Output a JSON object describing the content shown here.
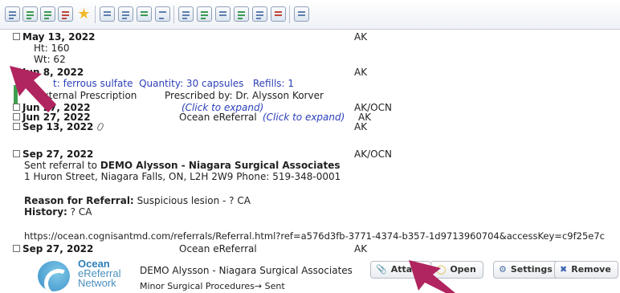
{
  "colors": {
    "accent_link": "#2b3fb8",
    "checkbox_checked": "#2a6fc9",
    "annotation_arrow": "#b0245f",
    "green_bar": "#3f9e4c"
  },
  "toolbar": {
    "icons": [
      "new-document-icon",
      "import-icon",
      "export-icon",
      "tools-icon",
      "star-icon",
      "scale-icon",
      "grid-icon",
      "history-icon",
      "chart-icon",
      "note-icon",
      "scan-icon",
      "lab-icon",
      "image-icon",
      "flowsheet-icon",
      "forms-icon",
      "graph-icon"
    ]
  },
  "entries": {
    "may13": {
      "date": "May 13, 2022",
      "provider": "AK",
      "ht": "Ht:  160",
      "wt": "Wt: 62"
    },
    "jun8": {
      "date": "Jun 8, 2022",
      "provider": "AK",
      "rx_prefix": "t:",
      "drug": "ferrous sulfate",
      "quantity": "Quantity: 30 capsules",
      "refills": "Refills: 1",
      "external": "External Prescription",
      "prescribed_by": "Prescribed by: Dr. Alysson Korver"
    },
    "jun27a": {
      "date": "Jun 27, 2022",
      "expand": "(Click to expand)",
      "provider": "AK/OCN"
    },
    "jun27b": {
      "date": "Jun 27, 2022",
      "label": "Ocean eReferral",
      "expand": "(Click to expand)",
      "provider": "AK"
    },
    "sep13": {
      "date": "Sep 13, 2022",
      "provider": "AK"
    },
    "sep27a": {
      "date": "Sep 27, 2022",
      "provider": "AK/OCN",
      "sent_prefix": "Sent referral to ",
      "recipient": "DEMO Alysson - Niagara Surgical Associates",
      "address": "1 Huron Street, Niagara Falls, ON, L2H 2W9  Phone: 519-348-0001",
      "reason_label": "Reason for Referral:",
      "reason": "Suspicious lesion - ? CA",
      "history_label": "History:",
      "history": "? CA",
      "url": "https://ocean.cognisantmd.com/referrals/Referral.html?ref=a576d3fb-3771-4374-b357-1d9713960704&accessKey=c9f25e7c"
    },
    "sep27b": {
      "date": "Sep 27, 2022",
      "label": "Ocean eReferral",
      "provider": "AK",
      "logo": {
        "line1": "Ocean",
        "line2": "eReferral",
        "line3": "Network"
      },
      "recipient": "DEMO Alysson - Niagara Surgical Associates",
      "procedure": "Minor Surgical Procedures→ Sent",
      "buttons": {
        "attach": "Attach",
        "open": "Open",
        "settings": "Settings",
        "remove": "Remove"
      }
    }
  }
}
